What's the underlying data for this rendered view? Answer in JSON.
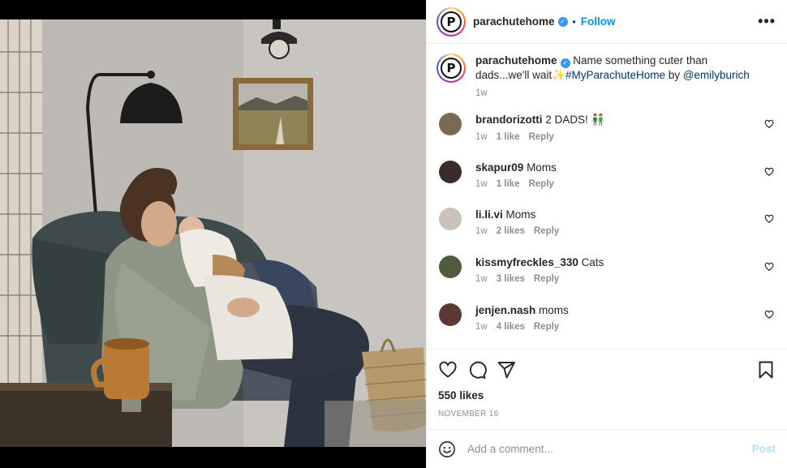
{
  "post": {
    "author": "parachutehome",
    "avatar_letter": "P",
    "follow_label": "Follow",
    "separator": "•",
    "more_label": "•••",
    "caption": {
      "author": "parachutehome",
      "text": "Name something cuter than dads...we'll wait",
      "sparkle": "✨",
      "hashtag": "#MyParachuteHome",
      "by_text": " by ",
      "mention": "@emilyburich",
      "time": "1w"
    },
    "likes": "550 likes",
    "date": "NOVEMBER 16"
  },
  "comments": [
    {
      "user": "brandorizotti",
      "text": "2 DADS! 👬",
      "time": "1w",
      "likes": "1 like",
      "reply": "Reply",
      "avatar_color": "#7a6a55"
    },
    {
      "user": "skapur09",
      "text": "Moms",
      "time": "1w",
      "likes": "1 like",
      "reply": "Reply",
      "avatar_color": "#3a2c28"
    },
    {
      "user": "li.li.vi",
      "text": "Moms",
      "time": "1w",
      "likes": "2 likes",
      "reply": "Reply",
      "avatar_color": "#c9c2b8"
    },
    {
      "user": "kissmyfreckles_330",
      "text": "Cats",
      "time": "1w",
      "likes": "3 likes",
      "reply": "Reply",
      "avatar_color": "#4f5b3e"
    },
    {
      "user": "jenjen.nash",
      "text": "moms",
      "time": "1w",
      "likes": "4 likes",
      "reply": "Reply",
      "avatar_color": "#5a3a30"
    }
  ],
  "composer": {
    "placeholder": "Add a comment...",
    "post_label": "Post"
  },
  "colors": {
    "accent": "#0095f6",
    "verified": "#3897f0",
    "post_disabled": "#b2dffc"
  },
  "icons": [
    "heart-icon",
    "comment-icon",
    "share-icon",
    "bookmark-icon",
    "emoji-icon",
    "verified-icon",
    "more-icon"
  ]
}
